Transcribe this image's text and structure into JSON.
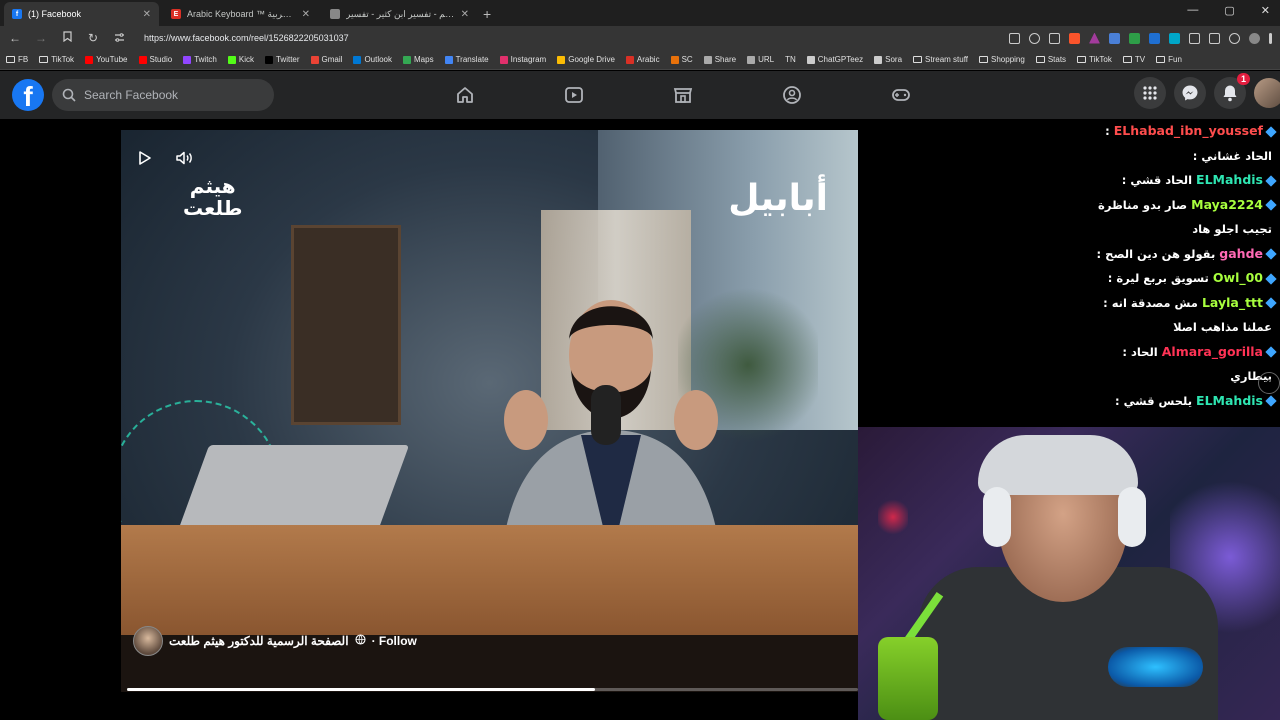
{
  "browser": {
    "tabs": [
      {
        "title": "(1) Facebook",
        "favicon_color": "#1877f2",
        "favicon_letter": "f",
        "active": true
      },
      {
        "title": "Arabic Keyboard ™ لوحة المفاتيح العربية",
        "favicon_color": "#d93025",
        "favicon_letter": "E",
        "active": false
      },
      {
        "title": "القرآن الكريم - تفسير ابن كثير - تفسير",
        "favicon_color": "#888888",
        "favicon_letter": "",
        "active": false
      }
    ],
    "new_tab_label": "+",
    "window_controls": [
      "—",
      "▢",
      "✕"
    ],
    "url": "https://www.facebook.com/reel/1526822205031037"
  },
  "bookmarks": [
    {
      "label": "FB",
      "type": "folder"
    },
    {
      "label": "TikTok",
      "type": "folder"
    },
    {
      "label": "YouTube",
      "type": "icon",
      "color": "#ff0000"
    },
    {
      "label": "Studio",
      "type": "icon",
      "color": "#ff0000"
    },
    {
      "label": "Twitch",
      "type": "icon",
      "color": "#9146ff"
    },
    {
      "label": "Kick",
      "type": "icon",
      "color": "#53fc18"
    },
    {
      "label": "Twitter",
      "type": "icon",
      "color": "#000000"
    },
    {
      "label": "Gmail",
      "type": "icon",
      "color": "#ea4335"
    },
    {
      "label": "Outlook",
      "type": "icon",
      "color": "#0078d4"
    },
    {
      "label": "Maps",
      "type": "icon",
      "color": "#34a853"
    },
    {
      "label": "Translate",
      "type": "icon",
      "color": "#4285f4"
    },
    {
      "label": "Instagram",
      "type": "icon",
      "color": "#e1306c"
    },
    {
      "label": "Google Drive",
      "type": "icon",
      "color": "#fbbc04"
    },
    {
      "label": "Arabic",
      "type": "icon",
      "color": "#d93025"
    },
    {
      "label": "SC",
      "type": "icon",
      "color": "#e8710a"
    },
    {
      "label": "Share",
      "type": "icon",
      "color": "#aaaaaa"
    },
    {
      "label": "URL",
      "type": "icon",
      "color": "#aaaaaa"
    },
    {
      "label": "TN",
      "type": "text"
    },
    {
      "label": "ChatGPTeez",
      "type": "icon",
      "color": "#cccccc"
    },
    {
      "label": "Sora",
      "type": "icon",
      "color": "#cccccc"
    },
    {
      "label": "Stream stuff",
      "type": "folder"
    },
    {
      "label": "Shopping",
      "type": "folder"
    },
    {
      "label": "Stats",
      "type": "folder"
    },
    {
      "label": "TikTok",
      "type": "folder"
    },
    {
      "label": "TV",
      "type": "folder"
    },
    {
      "label": "Fun",
      "type": "folder"
    }
  ],
  "facebook": {
    "search_placeholder": "Search Facebook",
    "nav": [
      "home-icon",
      "video-icon",
      "marketplace-icon",
      "groups-icon",
      "gaming-icon"
    ],
    "notification_count": "1"
  },
  "video": {
    "overlay_right_logo": "أبابيل",
    "overlay_left_logo_line1": "هيثم",
    "overlay_left_logo_line2": "طلعت",
    "page_name": "الصفحة الرسمية للدكتور هيثم طلعت",
    "follow_label": "· Follow",
    "progress": 0.64
  },
  "chat": {
    "messages": [
      {
        "user": "ELhabad_ibn_youssef",
        "color": "#ff4d4d",
        "text": ":",
        "cont": "الحاد غشاني :"
      },
      {
        "user": "ELMahdis",
        "color": "#2ee6b2",
        "text": "الحاد قشي :",
        "cont": ""
      },
      {
        "user": "Maya2224",
        "color": "#a8ff3e",
        "text": "صار بدو مناظرة :",
        "cont": "تجيب اجلو هاد"
      },
      {
        "user": "gahde",
        "color": "#ff69b4",
        "text": "بقولو هن دين الصح :",
        "cont": ""
      },
      {
        "user": "Owl_00",
        "color": "#a8ff3e",
        "text": "تسويق بربع ليرة :",
        "cont": ""
      },
      {
        "user": "Layla_ttt",
        "color": "#a8ff3e",
        "text": "مش مصدقة انه :",
        "cont": "عملنا مذاهب اصلا"
      },
      {
        "user": "Almara_gorilla",
        "color": "#ff3355",
        "text": "الحاد :",
        "cont": "بيطاري"
      },
      {
        "user": "ELMahdis",
        "color": "#2ee6b2",
        "text": "يلحس قشي :",
        "cont": ""
      }
    ]
  }
}
